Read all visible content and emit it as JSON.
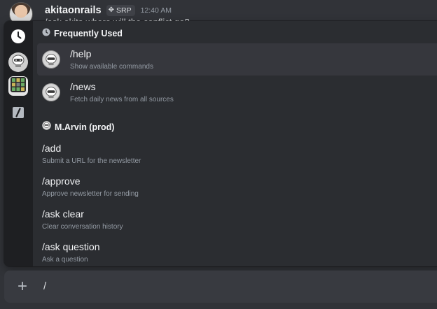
{
  "message": {
    "author": "akitaonrails",
    "tag_icon": "✥",
    "tag": "SRP",
    "time": "12:40 AM",
    "text": "/ask akita where will the conflict go?"
  },
  "rail": {
    "items": [
      {
        "name": "recent-icon"
      },
      {
        "name": "bot-avatar"
      },
      {
        "name": "app-grid-icon"
      },
      {
        "name": "slash-icon"
      }
    ]
  },
  "sections": {
    "frequent": {
      "title": "Frequently Used",
      "items": [
        {
          "name": "/help",
          "desc": "Show available commands"
        },
        {
          "name": "/news",
          "desc": "Fetch daily news from all sources"
        }
      ]
    },
    "bot": {
      "title": "M.Arvin (prod)",
      "items": [
        {
          "name": "/add",
          "desc": "Submit a URL for the newsletter"
        },
        {
          "name": "/approve",
          "desc": "Approve newsletter for sending"
        },
        {
          "name": "/ask clear",
          "desc": "Clear conversation history"
        },
        {
          "name": "/ask question",
          "desc": "Ask a question"
        }
      ]
    }
  },
  "input": {
    "plus": "+",
    "value": "/"
  },
  "colors": {
    "background": "#313338",
    "popup": "#2b2d31",
    "rail": "#1e1f22",
    "selected": "#36373d",
    "input_bar": "#383a40"
  }
}
